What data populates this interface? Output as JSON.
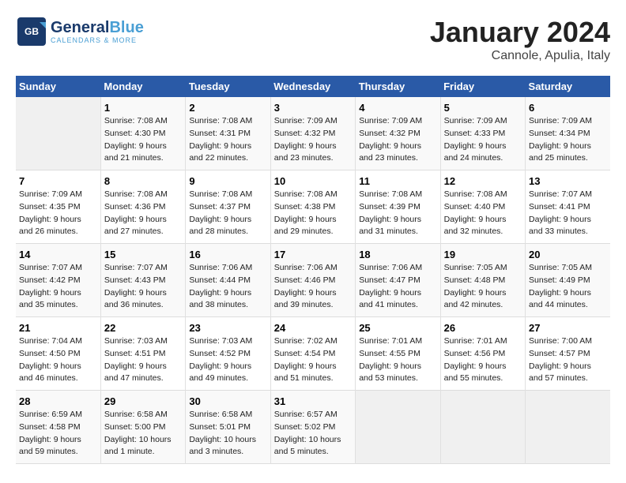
{
  "logo": {
    "line1": "General",
    "line2": "Blue"
  },
  "title": "January 2024",
  "location": "Cannole, Apulia, Italy",
  "headers": [
    "Sunday",
    "Monday",
    "Tuesday",
    "Wednesday",
    "Thursday",
    "Friday",
    "Saturday"
  ],
  "weeks": [
    [
      {
        "day": "",
        "sunrise": "",
        "sunset": "",
        "daylight": "",
        "empty": true
      },
      {
        "day": "1",
        "sunrise": "Sunrise: 7:08 AM",
        "sunset": "Sunset: 4:30 PM",
        "daylight": "Daylight: 9 hours and 21 minutes."
      },
      {
        "day": "2",
        "sunrise": "Sunrise: 7:08 AM",
        "sunset": "Sunset: 4:31 PM",
        "daylight": "Daylight: 9 hours and 22 minutes."
      },
      {
        "day": "3",
        "sunrise": "Sunrise: 7:09 AM",
        "sunset": "Sunset: 4:32 PM",
        "daylight": "Daylight: 9 hours and 23 minutes."
      },
      {
        "day": "4",
        "sunrise": "Sunrise: 7:09 AM",
        "sunset": "Sunset: 4:32 PM",
        "daylight": "Daylight: 9 hours and 23 minutes."
      },
      {
        "day": "5",
        "sunrise": "Sunrise: 7:09 AM",
        "sunset": "Sunset: 4:33 PM",
        "daylight": "Daylight: 9 hours and 24 minutes."
      },
      {
        "day": "6",
        "sunrise": "Sunrise: 7:09 AM",
        "sunset": "Sunset: 4:34 PM",
        "daylight": "Daylight: 9 hours and 25 minutes."
      }
    ],
    [
      {
        "day": "7",
        "sunrise": "Sunrise: 7:09 AM",
        "sunset": "Sunset: 4:35 PM",
        "daylight": "Daylight: 9 hours and 26 minutes."
      },
      {
        "day": "8",
        "sunrise": "Sunrise: 7:08 AM",
        "sunset": "Sunset: 4:36 PM",
        "daylight": "Daylight: 9 hours and 27 minutes."
      },
      {
        "day": "9",
        "sunrise": "Sunrise: 7:08 AM",
        "sunset": "Sunset: 4:37 PM",
        "daylight": "Daylight: 9 hours and 28 minutes."
      },
      {
        "day": "10",
        "sunrise": "Sunrise: 7:08 AM",
        "sunset": "Sunset: 4:38 PM",
        "daylight": "Daylight: 9 hours and 29 minutes."
      },
      {
        "day": "11",
        "sunrise": "Sunrise: 7:08 AM",
        "sunset": "Sunset: 4:39 PM",
        "daylight": "Daylight: 9 hours and 31 minutes."
      },
      {
        "day": "12",
        "sunrise": "Sunrise: 7:08 AM",
        "sunset": "Sunset: 4:40 PM",
        "daylight": "Daylight: 9 hours and 32 minutes."
      },
      {
        "day": "13",
        "sunrise": "Sunrise: 7:07 AM",
        "sunset": "Sunset: 4:41 PM",
        "daylight": "Daylight: 9 hours and 33 minutes."
      }
    ],
    [
      {
        "day": "14",
        "sunrise": "Sunrise: 7:07 AM",
        "sunset": "Sunset: 4:42 PM",
        "daylight": "Daylight: 9 hours and 35 minutes."
      },
      {
        "day": "15",
        "sunrise": "Sunrise: 7:07 AM",
        "sunset": "Sunset: 4:43 PM",
        "daylight": "Daylight: 9 hours and 36 minutes."
      },
      {
        "day": "16",
        "sunrise": "Sunrise: 7:06 AM",
        "sunset": "Sunset: 4:44 PM",
        "daylight": "Daylight: 9 hours and 38 minutes."
      },
      {
        "day": "17",
        "sunrise": "Sunrise: 7:06 AM",
        "sunset": "Sunset: 4:46 PM",
        "daylight": "Daylight: 9 hours and 39 minutes."
      },
      {
        "day": "18",
        "sunrise": "Sunrise: 7:06 AM",
        "sunset": "Sunset: 4:47 PM",
        "daylight": "Daylight: 9 hours and 41 minutes."
      },
      {
        "day": "19",
        "sunrise": "Sunrise: 7:05 AM",
        "sunset": "Sunset: 4:48 PM",
        "daylight": "Daylight: 9 hours and 42 minutes."
      },
      {
        "day": "20",
        "sunrise": "Sunrise: 7:05 AM",
        "sunset": "Sunset: 4:49 PM",
        "daylight": "Daylight: 9 hours and 44 minutes."
      }
    ],
    [
      {
        "day": "21",
        "sunrise": "Sunrise: 7:04 AM",
        "sunset": "Sunset: 4:50 PM",
        "daylight": "Daylight: 9 hours and 46 minutes."
      },
      {
        "day": "22",
        "sunrise": "Sunrise: 7:03 AM",
        "sunset": "Sunset: 4:51 PM",
        "daylight": "Daylight: 9 hours and 47 minutes."
      },
      {
        "day": "23",
        "sunrise": "Sunrise: 7:03 AM",
        "sunset": "Sunset: 4:52 PM",
        "daylight": "Daylight: 9 hours and 49 minutes."
      },
      {
        "day": "24",
        "sunrise": "Sunrise: 7:02 AM",
        "sunset": "Sunset: 4:54 PM",
        "daylight": "Daylight: 9 hours and 51 minutes."
      },
      {
        "day": "25",
        "sunrise": "Sunrise: 7:01 AM",
        "sunset": "Sunset: 4:55 PM",
        "daylight": "Daylight: 9 hours and 53 minutes."
      },
      {
        "day": "26",
        "sunrise": "Sunrise: 7:01 AM",
        "sunset": "Sunset: 4:56 PM",
        "daylight": "Daylight: 9 hours and 55 minutes."
      },
      {
        "day": "27",
        "sunrise": "Sunrise: 7:00 AM",
        "sunset": "Sunset: 4:57 PM",
        "daylight": "Daylight: 9 hours and 57 minutes."
      }
    ],
    [
      {
        "day": "28",
        "sunrise": "Sunrise: 6:59 AM",
        "sunset": "Sunset: 4:58 PM",
        "daylight": "Daylight: 9 hours and 59 minutes."
      },
      {
        "day": "29",
        "sunrise": "Sunrise: 6:58 AM",
        "sunset": "Sunset: 5:00 PM",
        "daylight": "Daylight: 10 hours and 1 minute."
      },
      {
        "day": "30",
        "sunrise": "Sunrise: 6:58 AM",
        "sunset": "Sunset: 5:01 PM",
        "daylight": "Daylight: 10 hours and 3 minutes."
      },
      {
        "day": "31",
        "sunrise": "Sunrise: 6:57 AM",
        "sunset": "Sunset: 5:02 PM",
        "daylight": "Daylight: 10 hours and 5 minutes."
      },
      {
        "day": "",
        "sunrise": "",
        "sunset": "",
        "daylight": "",
        "empty": true
      },
      {
        "day": "",
        "sunrise": "",
        "sunset": "",
        "daylight": "",
        "empty": true
      },
      {
        "day": "",
        "sunrise": "",
        "sunset": "",
        "daylight": "",
        "empty": true
      }
    ]
  ]
}
